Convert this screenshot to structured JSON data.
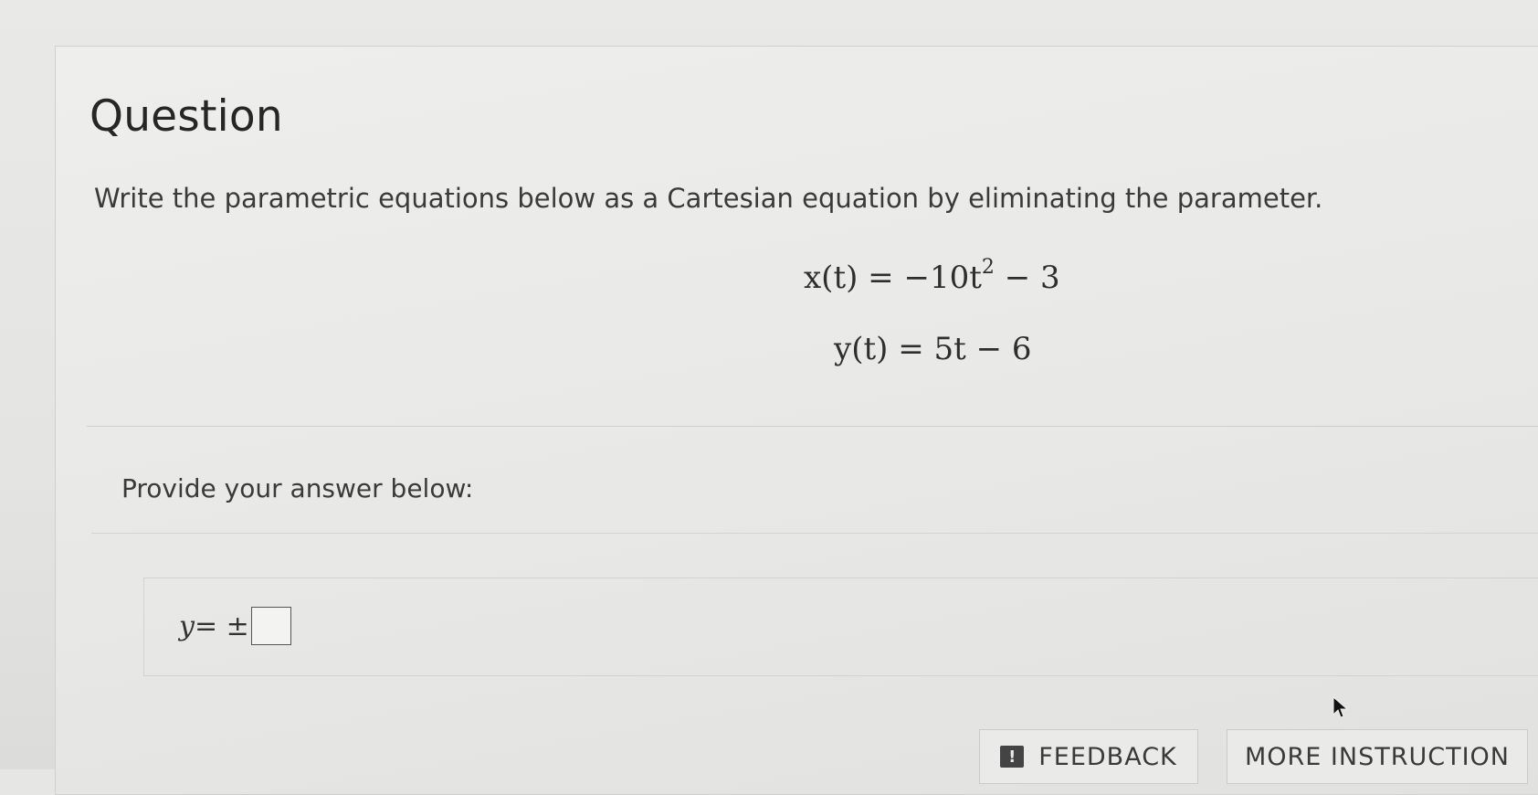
{
  "question": {
    "title": "Question",
    "prompt": "Write the parametric equations below as a Cartesian equation by eliminating the parameter.",
    "equations": {
      "x_lhs": "x(t) = −10t",
      "x_exp": "2",
      "x_rhs": " − 3",
      "y": "y(t) = 5t − 6"
    }
  },
  "answer": {
    "label": "Provide your answer below:",
    "lhs_var": "y",
    "operator": " = ±",
    "input_value": ""
  },
  "buttons": {
    "feedback_icon": "!",
    "feedback_label": "FEEDBACK",
    "more_label": "MORE INSTRUCTION"
  },
  "icons": {
    "feedback": "feedback-icon",
    "cursor": "mouse-cursor-icon"
  }
}
